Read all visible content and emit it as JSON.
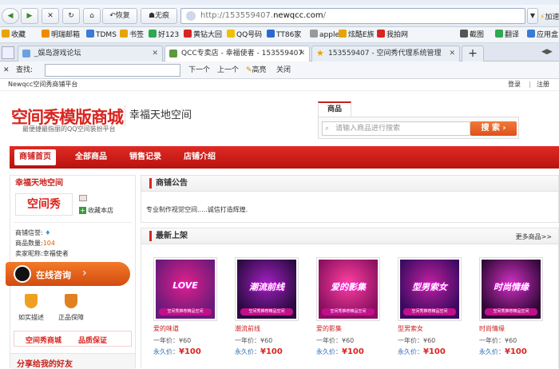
{
  "browser": {
    "back_label": "◀",
    "forward_label": "▶",
    "restore_label": "恢复",
    "ads_label": "无痕",
    "url_prefix": "http://153559407.",
    "url_domain": "newqcc.com",
    "url_suffix": "/",
    "speedup_label": "加速"
  },
  "bookmarks": [
    {
      "label": "收藏",
      "color": "#e6a400"
    },
    {
      "label": "明瑞邮箱",
      "color": "#f08a00"
    },
    {
      "label": "TDMS",
      "color": "#3a7bd5"
    },
    {
      "label": "书签",
      "color": "#e6a400"
    },
    {
      "label": "好123",
      "color": "#2fa84f"
    },
    {
      "label": "黄钻大回",
      "color": "#d9241f"
    },
    {
      "label": "QQ号码",
      "color": "#f0c000"
    },
    {
      "label": "TT86家",
      "color": "#2a6ad0"
    },
    {
      "label": "apple",
      "color": "#999999"
    },
    {
      "label": "炫酷E族",
      "color": "#e6a400"
    },
    {
      "label": "我拍网",
      "color": "#d9241f"
    },
    {
      "label": "截图",
      "color": "#555555"
    },
    {
      "label": "翻译",
      "color": "#2fa84f"
    },
    {
      "label": "应用盒",
      "color": "#3a7bd5"
    }
  ],
  "tabs": [
    {
      "label": "_娱岛游戏论坛",
      "active": false
    },
    {
      "label": "QCC专卖店 - 幸福使者 - 153559407",
      "active": true
    },
    {
      "label": "153559407 - 空间秀代理系统管理",
      "active": false
    }
  ],
  "findbar": {
    "label": "查找:",
    "next": "下一个",
    "prev": "上一个",
    "highlight": "高亮",
    "close": "关闭"
  },
  "site": {
    "top_left": "Newqcc空间秀商铺平台",
    "login": "登录",
    "sep": "|",
    "register": "注册",
    "logo": "空间秀模版商城",
    "slogan": "最便捷最指丽的QQ空间装扮平台",
    "shop_name": "幸福天地空间",
    "search_tab": "商品",
    "search_placeholder": "请输入商品进行搜索",
    "search_button": "搜 索",
    "nav": [
      "商铺首页",
      "全部商品",
      "销售记录",
      "店铺介绍"
    ]
  },
  "left": {
    "title": "幸福天地空间",
    "logo_text": "空间秀",
    "fav_button": "收藏本店",
    "credit_label": "商铺信誉:",
    "count_label": "商品数量:",
    "count_value": "104",
    "seller_label": "卖家昵称:",
    "seller_value": "幸福使者",
    "consult": "在线咨询",
    "badge1": "如实描述",
    "badge2": "正品保障",
    "banner1": "空间秀商城",
    "banner2": "品质保证",
    "share": "分享给我的好友"
  },
  "notice": {
    "title": "商铺公告",
    "text": "专业制作视觉空间.....诚信打造辉煌."
  },
  "newest": {
    "title": "最新上架",
    "more": "更多商品>>",
    "products": [
      {
        "name": "爱的味道",
        "year_price": "一年价：¥60",
        "forever_label": "永久价：",
        "forever_price": "¥100",
        "art": "LOVE",
        "c1": "#6a1a7a",
        "c2": "#e0208a"
      },
      {
        "name": "潮流前线",
        "year_price": "一年价：¥60",
        "forever_label": "永久价：",
        "forever_price": "¥100",
        "art": "潮流前线",
        "c1": "#2a0a40",
        "c2": "#a020c0"
      },
      {
        "name": "爱的影集",
        "year_price": "一年价：¥60",
        "forever_label": "永久价：",
        "forever_price": "¥100",
        "art": "爱的影集",
        "c1": "#8a1060",
        "c2": "#ff40a0"
      },
      {
        "name": "型男索女",
        "year_price": "一年价：¥60",
        "forever_label": "永久价：",
        "forever_price": "¥100",
        "art": "型男索女",
        "c1": "#3a0a60",
        "c2": "#c020a0"
      },
      {
        "name": "时尚情缘",
        "year_price": "一年价：¥60",
        "forever_label": "永久价：",
        "forever_price": "¥100",
        "art": "时尚情缘",
        "c1": "#300838",
        "c2": "#d030c0"
      }
    ],
    "product_footer": "空间秀推荐精品空间"
  }
}
